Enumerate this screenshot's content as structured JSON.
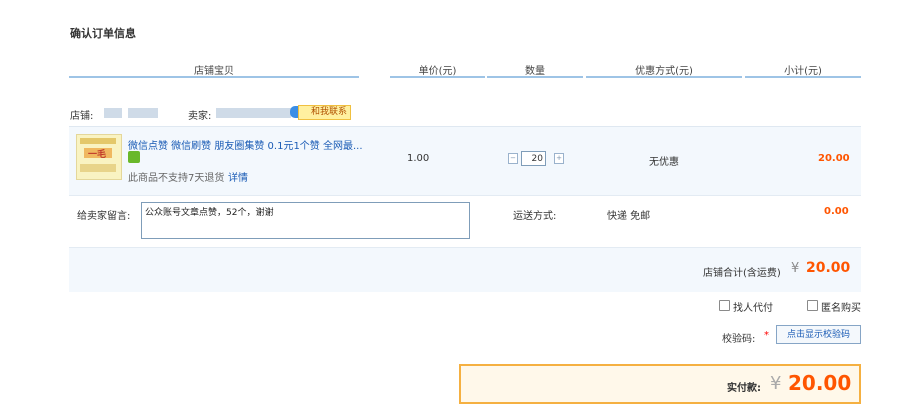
{
  "page": {
    "title": "确认订单信息"
  },
  "table": {
    "headers": [
      "店铺宝贝",
      "单价(元)",
      "数量",
      "优惠方式(元)",
      "小计(元)"
    ]
  },
  "shop": {
    "shop_label": "店铺:",
    "seller_label": "卖家:",
    "contact_tag": "和我联系"
  },
  "item": {
    "title": "微信点赞 微信刷赞 朋友圈集赞 0.1元1个赞 全网最...",
    "no_return": "此商品不支持7天退货",
    "detail_link": "详情",
    "thumb_text": "一毛",
    "unit_price": "1.00",
    "quantity": "20",
    "discount": "无优惠",
    "subtotal": "20.00"
  },
  "message": {
    "label": "给卖家留言:",
    "value": "公众账号文章点赞，52个，谢谢"
  },
  "shipping": {
    "label": "运送方式:",
    "method": "快递 免邮",
    "fee": "0.00"
  },
  "total": {
    "label": "店铺合计(含运费)",
    "currency": "¥",
    "amount": "20.00"
  },
  "options": {
    "proxy_pay": "找人代付",
    "anonymous": "匿名购买"
  },
  "captcha": {
    "label": "校验码:",
    "required_mark": "*",
    "button": "点击显示校验码"
  },
  "payment": {
    "label": "实付款:",
    "currency": "¥",
    "amount": "20.00"
  },
  "colors": {
    "accent": "#ff5500",
    "link": "#1a5bb5",
    "header_line": "#9ec4e6",
    "pay_border": "#f5b041"
  }
}
